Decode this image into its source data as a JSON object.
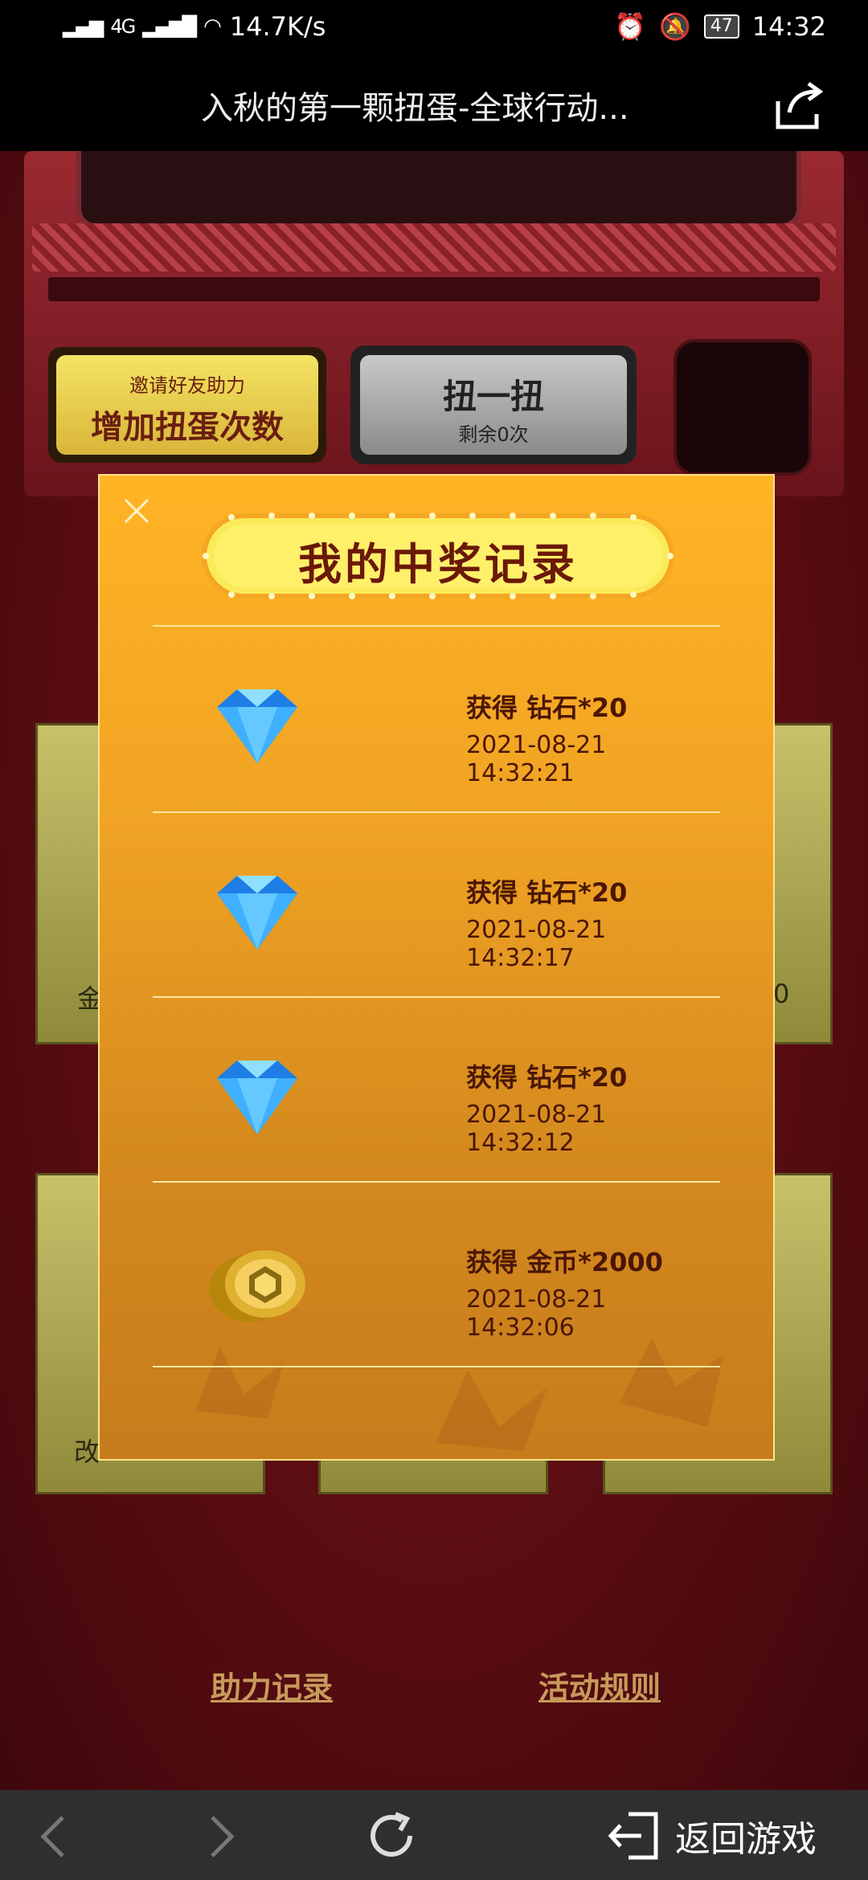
{
  "status": {
    "network_speed": "14.7K/s",
    "signal_label": "4G",
    "battery": "47",
    "time": "14:32"
  },
  "titlebar": {
    "title": "入秋的第一颗扭蛋-全球行动..."
  },
  "machine": {
    "invite_top": "邀请好友助力",
    "invite_main": "增加扭蛋次数",
    "spin_main": "扭一扭",
    "spin_sub": "剩余0次"
  },
  "cards": {
    "left_mid_label": "金",
    "right_mid_label": "0",
    "left_bottom_label": "改"
  },
  "modal": {
    "title": "我的中奖记录",
    "records": [
      {
        "prize": "获得  钻石*20",
        "time": "2021-08-21   14:32:21",
        "icon": "diamond-icon"
      },
      {
        "prize": "获得  钻石*20",
        "time": "2021-08-21   14:32:17",
        "icon": "diamond-icon"
      },
      {
        "prize": "获得  钻石*20",
        "time": "2021-08-21   14:32:12",
        "icon": "diamond-icon"
      },
      {
        "prize": "获得  金币*2000",
        "time": "2021-08-21   14:32:06",
        "icon": "gold-coin-icon"
      }
    ]
  },
  "links": {
    "assist_records": "助力记录",
    "activity_rules": "活动规则"
  },
  "nav": {
    "return_game": "返回游戏"
  },
  "colors": {
    "modal_top": "#ffb425",
    "modal_bottom": "#c77c1c",
    "text_dark": "#4a1606",
    "link": "#c79a5a"
  }
}
